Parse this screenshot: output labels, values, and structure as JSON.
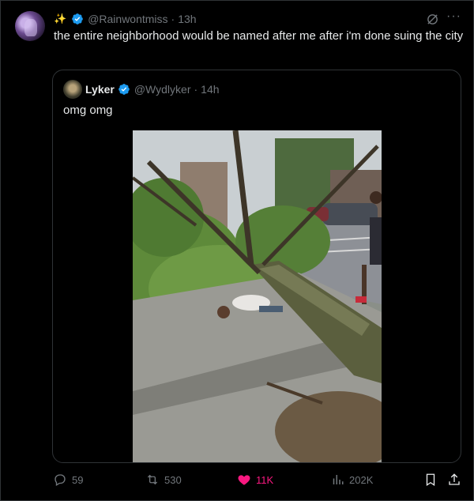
{
  "tweet": {
    "author_emoji": "✨",
    "handle": "@Rainwontmiss",
    "separator": "·",
    "time": "13h",
    "text": "the entire neighborhood would be named after me after i'm done suing the city",
    "more_label": "···"
  },
  "quote": {
    "name": "Lyker",
    "handle": "@Wydlyker",
    "separator": "·",
    "time": "14h",
    "text": "omg omg"
  },
  "actions": {
    "replies": "59",
    "reposts": "530",
    "likes": "11K",
    "views": "202K"
  },
  "colors": {
    "background": "#000000",
    "verified": "#1d9bf0",
    "like": "#f91880",
    "muted": "#71767b",
    "border": "#2f3336"
  }
}
